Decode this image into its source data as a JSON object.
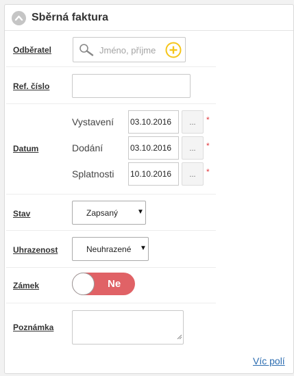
{
  "panel": {
    "title": "Sběrná faktura"
  },
  "fields": {
    "customer": {
      "label": "Odběratel",
      "placeholder": "Jméno, příjme"
    },
    "ref": {
      "label": "Ref. číslo",
      "value": ""
    },
    "date": {
      "label": "Datum",
      "browse_label": "...",
      "required_mark": "*",
      "issued": {
        "label": "Vystavení",
        "value": "03.10.2016"
      },
      "delivered": {
        "label": "Dodání",
        "value": "03.10.2016"
      },
      "due": {
        "label": "Splatnosti",
        "value": "10.10.2016"
      }
    },
    "status": {
      "label": "Stav",
      "value": "Zapsaný"
    },
    "payment": {
      "label": "Uhrazenost",
      "value": "Neuhrazené"
    },
    "lock": {
      "label": "Zámek",
      "value": "Ne"
    },
    "note": {
      "label": "Poznámka",
      "value": ""
    }
  },
  "footer": {
    "more_fields": "Víc polí"
  },
  "colors": {
    "toggle_off": "#e06266",
    "add_icon": "#f5c518",
    "required": "#e0393e",
    "link": "#2b6cb0"
  }
}
